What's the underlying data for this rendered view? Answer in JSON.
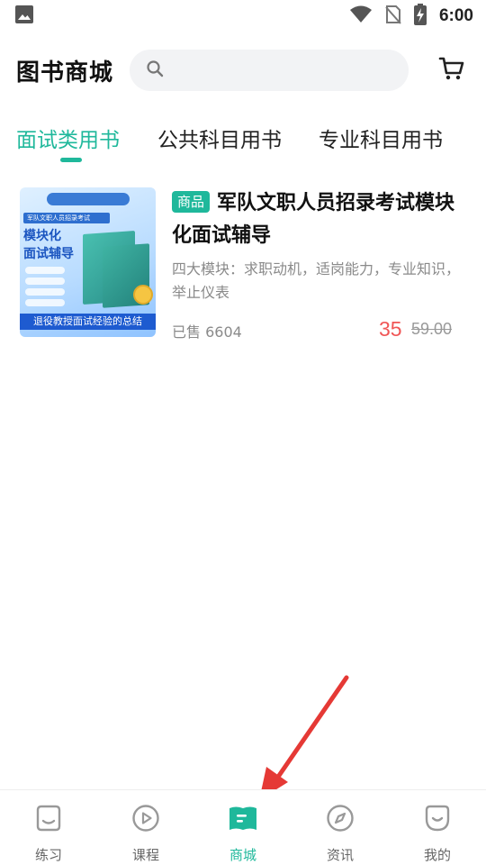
{
  "status_bar": {
    "time": "6:00"
  },
  "header": {
    "title": "图书商城",
    "search_placeholder": ""
  },
  "tabs": [
    {
      "label": "面试类用书",
      "active": true
    },
    {
      "label": "公共科目用书",
      "active": false
    },
    {
      "label": "专业科目用书",
      "active": false
    }
  ],
  "products": [
    {
      "badge": "商品",
      "title": "军队文职人员招录考试模块化面试辅导",
      "description": "四大模块：求职动机，适岗能力，专业知识，举止仪表",
      "sold": "已售 6604",
      "price": "35",
      "original_price": "59.00",
      "cover": {
        "tag_line": "军队文职人员招录考试",
        "big_title_1": "模块化",
        "big_title_2": "面试辅导",
        "bottom_text": "退役教授面试经验的总结"
      }
    }
  ],
  "bottom_nav": [
    {
      "label": "练习",
      "icon": "practice-icon",
      "active": false
    },
    {
      "label": "课程",
      "icon": "play-circle-icon",
      "active": false
    },
    {
      "label": "商城",
      "icon": "book-icon",
      "active": true
    },
    {
      "label": "资讯",
      "icon": "compass-icon",
      "active": false
    },
    {
      "label": "我的",
      "icon": "profile-icon",
      "active": false
    }
  ],
  "colors": {
    "accent": "#1fb89b",
    "price": "#f05656",
    "annotation_arrow": "#e53935"
  }
}
